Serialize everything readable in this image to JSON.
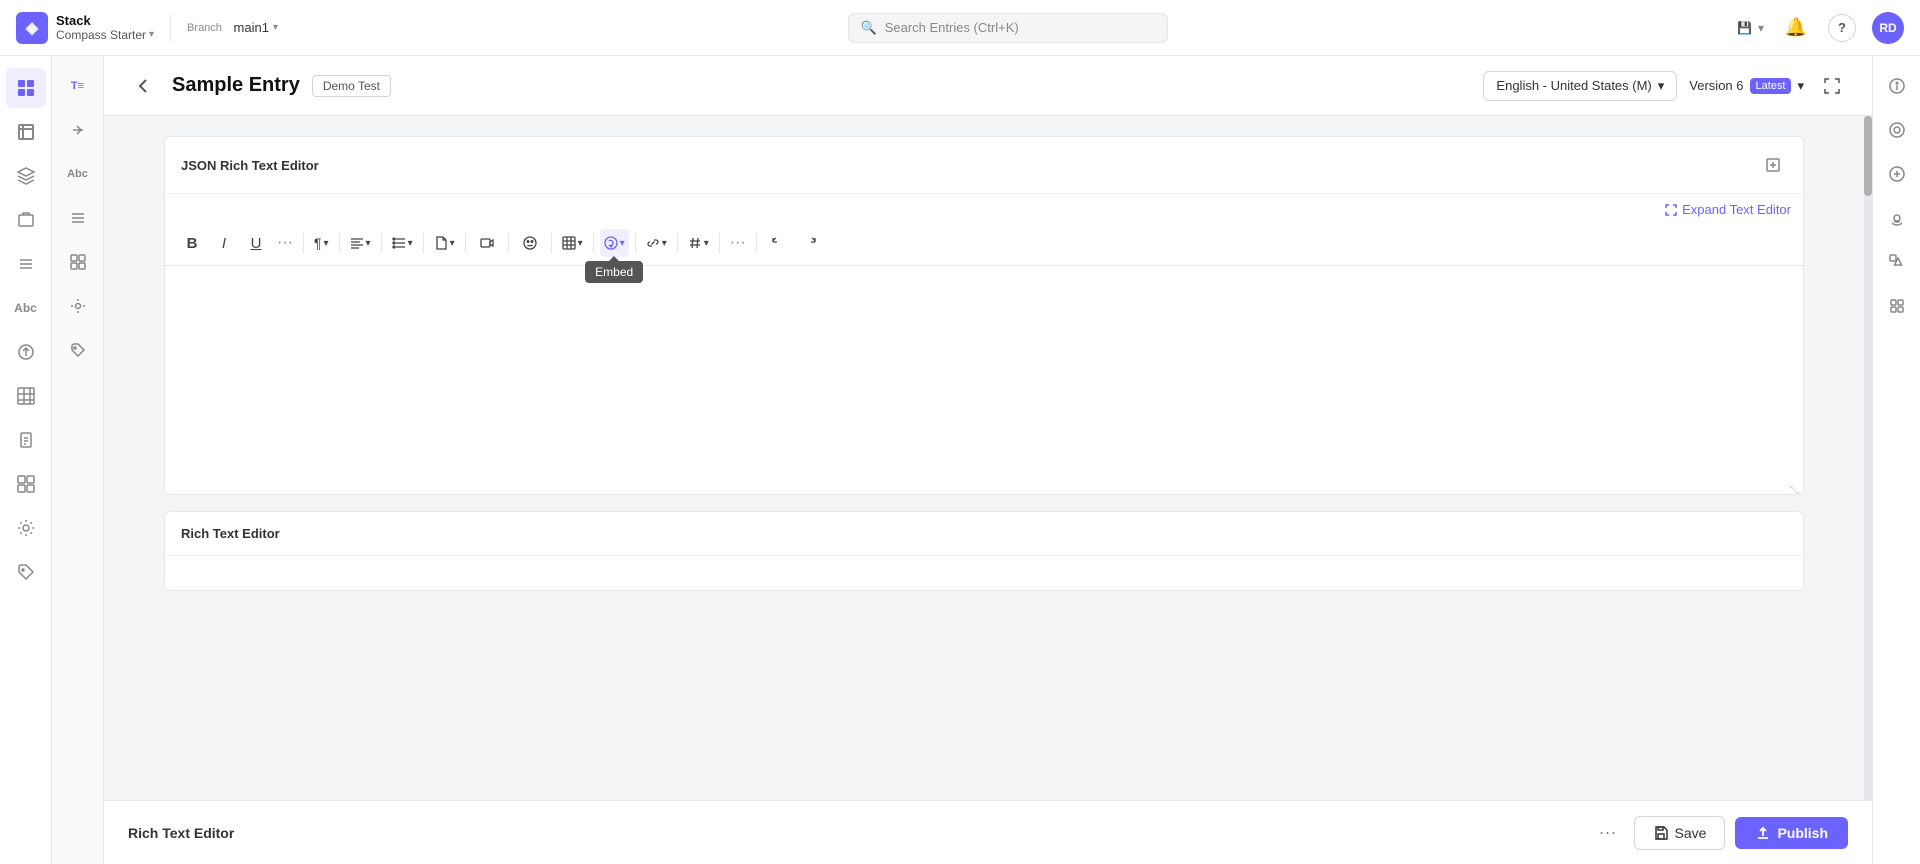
{
  "app": {
    "logo_icon": "◈",
    "brand_top": "Stack",
    "brand_sub": "Compass Starter",
    "brand_sub_chevron": "▾"
  },
  "branch": {
    "label": "Branch",
    "name": "main1",
    "chevron": "▾"
  },
  "search": {
    "placeholder": "Search Entries (Ctrl+K)"
  },
  "nav": {
    "save_icon": "💾",
    "chevron_down": "▾",
    "bell_icon": "🔔",
    "help_icon": "?",
    "avatar": "RD"
  },
  "sidebar": {
    "items": [
      {
        "icon": "⊞",
        "label": "dashboard",
        "active": true
      },
      {
        "icon": "≡",
        "label": "entries",
        "active": false
      },
      {
        "icon": "◎",
        "label": "layers",
        "active": false
      },
      {
        "icon": "↑",
        "label": "upload",
        "active": false
      },
      {
        "icon": "≡≡",
        "label": "list",
        "active": false
      },
      {
        "icon": "Abc",
        "label": "text",
        "active": false
      },
      {
        "icon": "⬆",
        "label": "push",
        "active": false
      },
      {
        "icon": "▤",
        "label": "grid",
        "active": false
      },
      {
        "icon": "📋",
        "label": "clipboard",
        "active": false
      },
      {
        "icon": "⊞",
        "label": "modules",
        "active": false
      },
      {
        "icon": "⚙",
        "label": "settings",
        "active": false
      },
      {
        "icon": "◇",
        "label": "tag",
        "active": false
      }
    ]
  },
  "secondary_sidebar": {
    "items": [
      {
        "icon": "T≡",
        "label": "T≡"
      },
      {
        "icon": "↩",
        "label": ""
      },
      {
        "icon": "Abc",
        "label": "Abc"
      },
      {
        "icon": "≡",
        "label": ""
      },
      {
        "icon": "⊞",
        "label": ""
      },
      {
        "icon": "⚙",
        "label": ""
      },
      {
        "icon": "◇",
        "label": ""
      }
    ]
  },
  "entry": {
    "back_icon": "←",
    "title": "Sample Entry",
    "badge": "Demo Test",
    "language": "English - United States (M)",
    "version_label": "Version 6",
    "version_badge": "Latest",
    "expand_icon": "⛶"
  },
  "json_editor": {
    "title": "JSON Rich Text Editor",
    "add_icon": "⊕",
    "expand_text_link": "Expand Text Editor",
    "expand_icon": "⛶"
  },
  "toolbar": {
    "bold": "B",
    "italic": "I",
    "underline": "U",
    "more_format": "···",
    "paragraph": "¶",
    "align": "≡",
    "list": "☰",
    "file": "📄",
    "video": "▶",
    "smiley": "☺",
    "table": "⊞",
    "embed_icon": "⊕",
    "link": "🔗",
    "hash": "#",
    "more": "···",
    "undo": "↩",
    "redo": "↪",
    "embed_tooltip": "Embed"
  },
  "right_panel": {
    "icons": [
      "ℹ",
      "◎",
      "⊕",
      "((·))",
      "◇▷",
      "⊞"
    ]
  },
  "bottom": {
    "rich_text_label": "Rich Text Editor",
    "more_icon": "···",
    "save_icon": "💾",
    "save_label": "Save",
    "publish_icon": "↑",
    "publish_label": "Publish"
  }
}
